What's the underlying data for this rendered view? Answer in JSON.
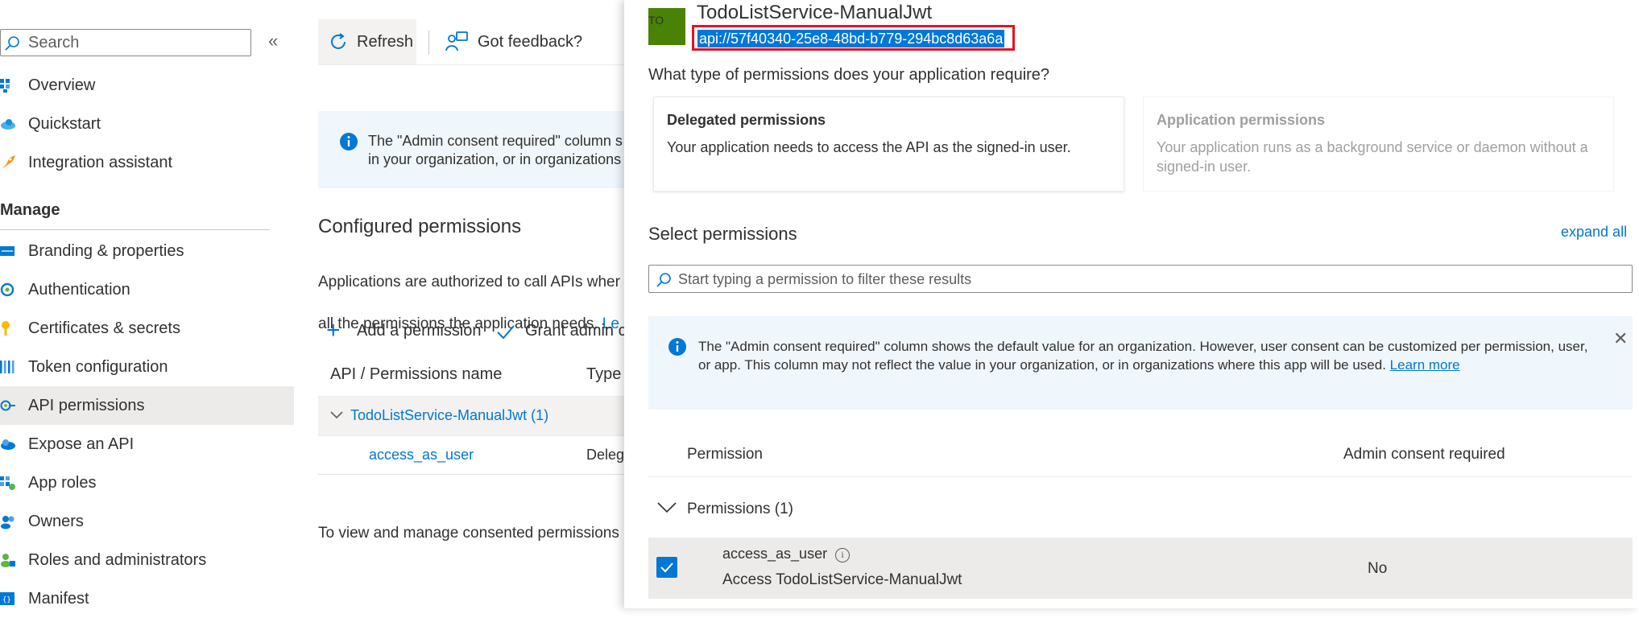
{
  "sidebar": {
    "search_placeholder": "Search",
    "collapse_glyph": "«",
    "items_top": [
      {
        "label": "Overview",
        "icon": "overview-grid-icon",
        "color": "#0078d4"
      },
      {
        "label": "Quickstart",
        "icon": "quickstart-cloud-icon",
        "color": "#50e6ff"
      },
      {
        "label": "Integration assistant",
        "icon": "rocket-icon",
        "color": "#ff8c00"
      }
    ],
    "manage_heading": "Manage",
    "items_manage": [
      {
        "label": "Branding & properties",
        "icon": "branding-icon"
      },
      {
        "label": "Authentication",
        "icon": "authentication-icon"
      },
      {
        "label": "Certificates & secrets",
        "icon": "key-icon"
      },
      {
        "label": "Token configuration",
        "icon": "token-bars-icon"
      },
      {
        "label": "API permissions",
        "icon": "api-permissions-icon",
        "active": true
      },
      {
        "label": "Expose an API",
        "icon": "cloud-icon"
      },
      {
        "label": "App roles",
        "icon": "app-roles-icon"
      },
      {
        "label": "Owners",
        "icon": "owners-icon"
      },
      {
        "label": "Roles and administrators",
        "icon": "roles-admin-icon"
      },
      {
        "label": "Manifest",
        "icon": "manifest-icon"
      }
    ]
  },
  "toolbar": {
    "refresh_label": "Refresh",
    "feedback_label": "Got feedback?"
  },
  "main": {
    "info_text": "The \"Admin consent required\" column s\nin your organization, or in organizations",
    "configured_title": "Configured permissions",
    "configured_desc_line1": "Applications are authorized to call APIs wher",
    "configured_desc_line2": "all the permissions the application needs.",
    "configured_desc_link": "Le",
    "add_permission_label": "Add a permission",
    "grant_admin_label": "Grant admin c",
    "table_head_name": "API / Permissions name",
    "table_head_type": "Type",
    "group_label": "TodoListService-ManualJwt (1)",
    "row_name": "access_as_user",
    "row_type": "Deleg",
    "consent_note": "To view and manage consented permissions"
  },
  "panel": {
    "logo_text": "TO",
    "title": "TodoListService-ManualJwt",
    "uri": "api://57f40340-25e8-48bd-b779-294bc8d63a6a",
    "question": "What type of permissions does your application require?",
    "delegated": {
      "title": "Delegated permissions",
      "desc": "Your application needs to access the API as the signed-in user."
    },
    "application": {
      "title": "Application permissions",
      "desc": "Your application runs as a background service or daemon without a signed-in user."
    },
    "select_title": "Select permissions",
    "expand_all": "expand all",
    "filter_placeholder": "Start typing a permission to filter these results",
    "info_text": "The \"Admin consent required\" column shows the default value for an organization. However, user consent can be customized per permission, user, or app. This column may not reflect the value in your organization, or in organizations where this app will be used.",
    "info_link": "Learn more",
    "info_close": "✕",
    "col_permission": "Permission",
    "col_admin": "Admin consent required",
    "group_label": "Permissions (1)",
    "perm_name": "access_as_user",
    "perm_desc": "Access TodoListService-ManualJwt",
    "perm_consent": "No",
    "perm_checked": true
  },
  "colors": {
    "accent": "#0078d4",
    "highlight_border": "#e81123",
    "logo_bg": "#498205"
  }
}
